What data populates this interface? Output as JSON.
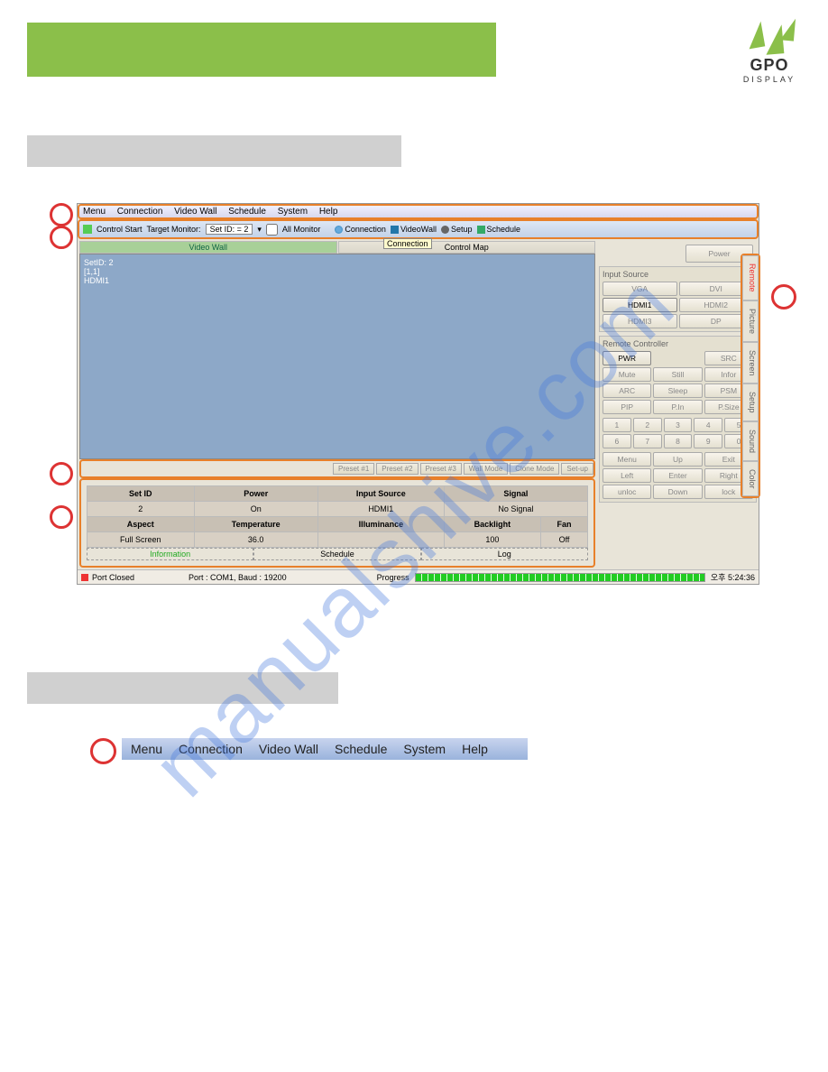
{
  "logo": {
    "name": "GPO",
    "sub": "DISPLAY"
  },
  "menuItems": [
    "Menu",
    "Connection",
    "Video Wall",
    "Schedule",
    "System",
    "Help"
  ],
  "toolbar": {
    "controlStart": "Control Start",
    "targetMonitor": "Target Monitor:",
    "setId": "Set ID: = 2",
    "allMonitor": "All Monitor",
    "btns": [
      "Connection",
      "VideoWall",
      "Setup",
      "Schedule"
    ]
  },
  "tooltip": "Connection",
  "viewTabs": [
    "Video Wall",
    "Control Map"
  ],
  "overlay": {
    "line1": "SetID: 2",
    "line2": "[1,1]",
    "line3": "HDMI1"
  },
  "presets": [
    "Preset #1",
    "Preset #2",
    "Preset #3",
    "Wall Mode",
    "Clone Mode",
    "Set-up"
  ],
  "infoHeaders1": [
    "Set ID",
    "Power",
    "Input Source",
    "Signal"
  ],
  "infoRow1": [
    "2",
    "On",
    "HDMI1",
    "No Signal"
  ],
  "infoHeaders2": [
    "Aspect",
    "Temperature",
    "Illuminance",
    "Backlight",
    "Fan"
  ],
  "infoRow2": [
    "Full Screen",
    "36.0",
    "",
    "100",
    "Off"
  ],
  "infoTabs": [
    "Information",
    "Schedule",
    "Log"
  ],
  "rightPanel": {
    "power": "Power",
    "inputSourceTitle": "Input Source",
    "inputs": [
      "VGA",
      "DVI",
      "HDMI1",
      "HDMI2",
      "HDMI3",
      "DP"
    ],
    "remoteTitle": "Remote Controller",
    "remote1": [
      "PWR",
      "",
      "SRC"
    ],
    "remote2": [
      "Mute",
      "Still",
      "Infor"
    ],
    "remote3": [
      "ARC",
      "Sleep",
      "PSM"
    ],
    "remote4": [
      "PIP",
      "P.In",
      "P.Size"
    ],
    "nums1": [
      "1",
      "2",
      "3",
      "4",
      "5"
    ],
    "nums2": [
      "6",
      "7",
      "8",
      "9",
      "0"
    ],
    "nav": {
      "menu": "Menu",
      "up": "Up",
      "exit": "Exit",
      "left": "Left",
      "enter": "Enter",
      "right": "Right",
      "unloc": "unloc",
      "down": "Down",
      "lock": "lock"
    }
  },
  "sideTabs": [
    "Remote",
    "Picture",
    "Screen",
    "Setup",
    "Sound",
    "Color"
  ],
  "status": {
    "portClosed": "Port Closed",
    "portInfo": "Port : COM1,  Baud : 19200",
    "progress": "Progress",
    "time": "오후 5:24:36"
  },
  "watermark": "manualshive.com"
}
